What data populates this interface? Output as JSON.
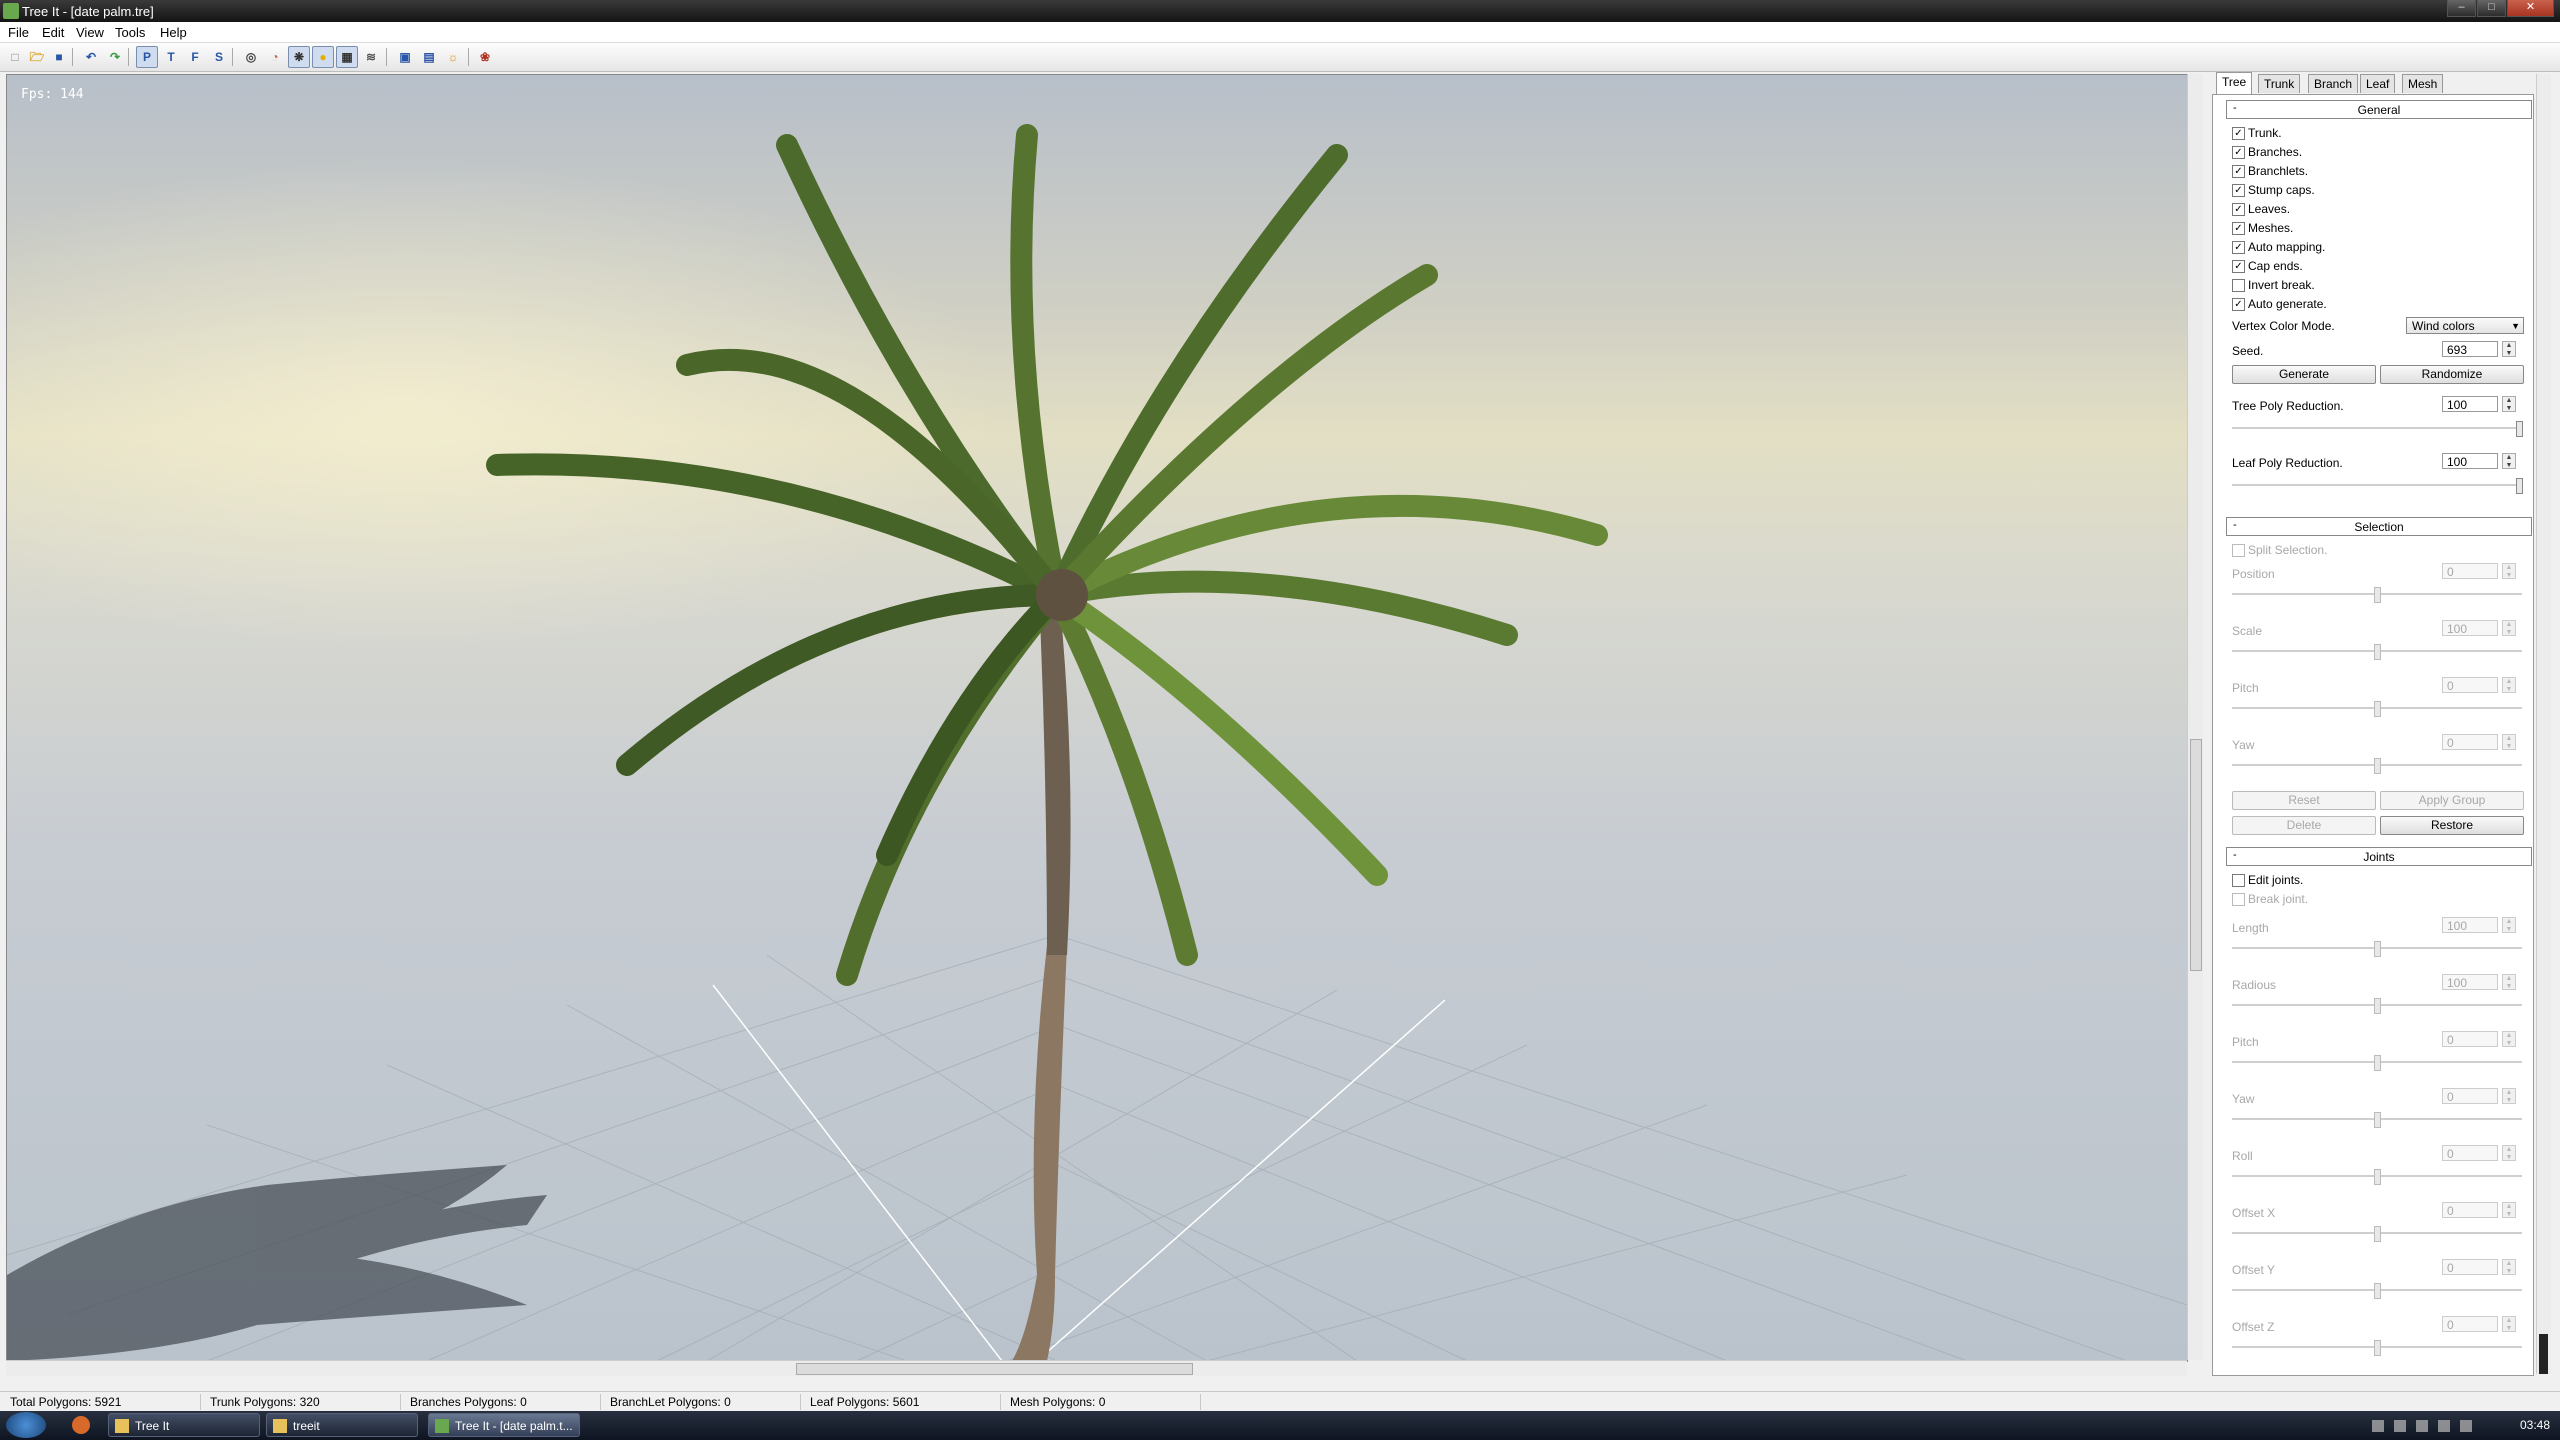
{
  "window": {
    "title": "Tree It - [date palm.tre]",
    "buttons": [
      "–",
      "□",
      "✕"
    ]
  },
  "menu": [
    "File",
    "Edit",
    "View",
    "Tools",
    "Help"
  ],
  "toolbar": {
    "letters": [
      "P",
      "T",
      "F",
      "S"
    ]
  },
  "viewport": {
    "fps": "Fps: 144"
  },
  "tabs": [
    "Tree",
    "Trunk",
    "Branch",
    "Leaf",
    "Mesh"
  ],
  "general": {
    "title": "General",
    "checkboxes": [
      {
        "label": "Trunk.",
        "checked": true
      },
      {
        "label": "Branches.",
        "checked": true
      },
      {
        "label": "Branchlets.",
        "checked": true
      },
      {
        "label": "Stump caps.",
        "checked": true
      },
      {
        "label": "Leaves.",
        "checked": true
      },
      {
        "label": "Meshes.",
        "checked": true
      },
      {
        "label": "Auto mapping.",
        "checked": true
      },
      {
        "label": "Cap ends.",
        "checked": true
      },
      {
        "label": "Invert break.",
        "checked": false
      },
      {
        "label": "Auto generate.",
        "checked": true
      }
    ],
    "vertex_color_label": "Vertex Color Mode.",
    "vertex_color_value": "Wind colors",
    "seed_label": "Seed.",
    "seed_value": "693",
    "generate": "Generate",
    "randomize": "Randomize",
    "tree_poly_label": "Tree Poly Reduction.",
    "tree_poly_value": "100",
    "leaf_poly_label": "Leaf Poly Reduction.",
    "leaf_poly_value": "100"
  },
  "selection": {
    "title": "Selection",
    "split_label": "Split Selection.",
    "fields": [
      {
        "label": "Position",
        "value": "0"
      },
      {
        "label": "Scale",
        "value": "100"
      },
      {
        "label": "Pitch",
        "value": "0"
      },
      {
        "label": "Yaw",
        "value": "0"
      }
    ],
    "reset": "Reset",
    "apply_group": "Apply Group",
    "delete": "Delete",
    "restore": "Restore"
  },
  "joints": {
    "title": "Joints",
    "edit_label": "Edit joints.",
    "break_label": "Break joint.",
    "fields": [
      {
        "label": "Length",
        "value": "100"
      },
      {
        "label": "Radious",
        "value": "100"
      },
      {
        "label": "Pitch",
        "value": "0"
      },
      {
        "label": "Yaw",
        "value": "0"
      },
      {
        "label": "Roll",
        "value": "0"
      },
      {
        "label": "Offset X",
        "value": "0"
      },
      {
        "label": "Offset Y",
        "value": "0"
      },
      {
        "label": "Offset Z",
        "value": "0"
      }
    ]
  },
  "status": {
    "total": "Total Polygons: 5921",
    "trunk": "Trunk Polygons: 320",
    "branches": "Branches Polygons: 0",
    "branchlet": "BranchLet Polygons: 0",
    "leaf": "Leaf Polygons:  5601",
    "mesh": "Mesh Polygons:  0"
  },
  "taskbar": {
    "items": [
      "Tree It",
      "treeit",
      "Tree It - [date palm.t..."
    ],
    "clock": "03:48"
  }
}
